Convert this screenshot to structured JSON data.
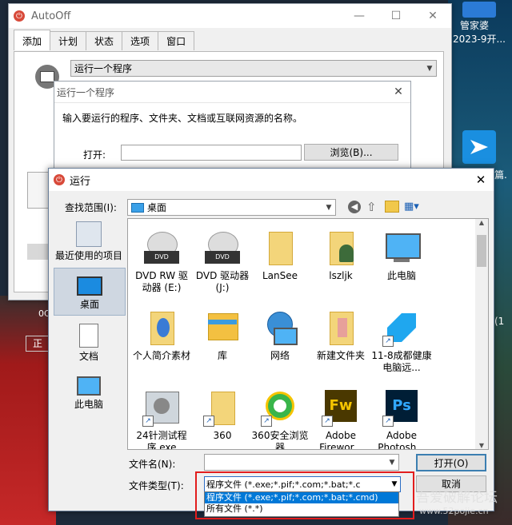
{
  "desktop": {
    "right_icon1_label": "管家婆",
    "right_text1": "2023-9开...",
    "right_text2": "篇.",
    "right_text3": "(1",
    "left_text1": "0C",
    "left_text2": "正",
    "watermark1": "吾爱破解论坛",
    "watermark2": "www.52pojie.cn"
  },
  "autooff": {
    "title": "AutoOff",
    "min": "—",
    "max": "☐",
    "close": "✕",
    "tabs": [
      "添加",
      "计划",
      "状态",
      "选项",
      "窗口"
    ],
    "action_value": "运行一个程序"
  },
  "run_program_dialog": {
    "title": "运行一个程序",
    "close": "✕",
    "prompt": "输入要运行的程序、文件夹、文档或互联网资源的名称。",
    "open_label": "打开:",
    "browse_button": "浏览(B)..."
  },
  "run_dialog": {
    "title": "运行",
    "close": "✕",
    "lookin_label": "查找范围(I):",
    "lookin_value": "桌面",
    "places": [
      "最近使用的项目",
      "桌面",
      "文档",
      "此电脑"
    ],
    "files": [
      {
        "name": "DVD RW 驱动器 (E:)",
        "icon": "dvd-drive-icon"
      },
      {
        "name": "DVD 驱动器 (J:)",
        "icon": "dvd-drive-icon"
      },
      {
        "name": "LanSee",
        "icon": "folder-icon"
      },
      {
        "name": "lszljk",
        "icon": "user-folder-icon"
      },
      {
        "name": "此电脑",
        "icon": "computer-icon"
      },
      {
        "name": "个人简介素材",
        "icon": "folder-icon"
      },
      {
        "name": "库",
        "icon": "library-icon"
      },
      {
        "name": "网络",
        "icon": "network-icon"
      },
      {
        "name": "新建文件夹",
        "icon": "folder-icon"
      },
      {
        "name": "11-8成都健康电脑远...",
        "icon": "app-icon"
      },
      {
        "name": "24针测试程序.exe",
        "icon": "printer-icon"
      },
      {
        "name": "360",
        "icon": "folder-icon"
      },
      {
        "name": "360安全浏览器",
        "icon": "browser-icon"
      },
      {
        "name": "Adobe Firewor...",
        "icon": "fw-icon"
      },
      {
        "name": "Adobe Photosh...",
        "icon": "ps-icon"
      }
    ],
    "filename_label": "文件名(N):",
    "filename_value": "",
    "filetype_label": "文件类型(T):",
    "filetype_value": "程序文件 (*.exe;*.pif;*.com;*.bat;*.c",
    "filetype_options": [
      "程序文件 (*.exe;*.pif;*.com;*.bat;*.cmd)",
      "所有文件 (*.*)"
    ],
    "open_button": "打开(O)",
    "cancel_button": "取消"
  }
}
